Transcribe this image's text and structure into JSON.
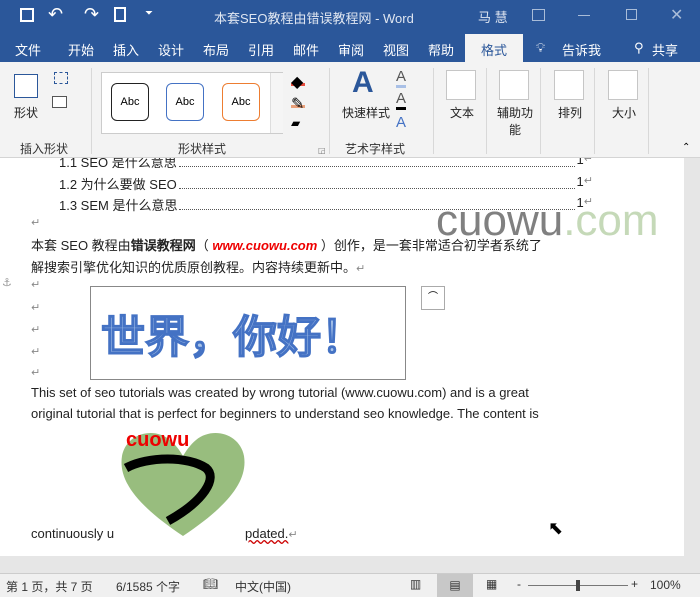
{
  "title": {
    "text": "本套SEO教程由错误教程网  -  Word",
    "user": "马 慧"
  },
  "quick_access": [
    "save-icon",
    "undo-icon",
    "redo-icon",
    "print-preview-icon",
    "customize-icon"
  ],
  "tabs": [
    {
      "label": "文件"
    },
    {
      "label": "开始"
    },
    {
      "label": "插入"
    },
    {
      "label": "设计"
    },
    {
      "label": "布局"
    },
    {
      "label": "引用"
    },
    {
      "label": "邮件"
    },
    {
      "label": "审阅"
    },
    {
      "label": "视图"
    },
    {
      "label": "帮助"
    },
    {
      "label": "格式"
    }
  ],
  "tell_me": "告诉我",
  "share": "共享",
  "ribbon": {
    "insert_shapes": {
      "shapes": "形状",
      "group": "插入形状"
    },
    "shape_styles": {
      "abc": [
        "Abc",
        "Abc",
        "Abc"
      ],
      "group": "形状样式"
    },
    "wordart": {
      "quick_styles": "快速样式",
      "group": "艺术字样式"
    },
    "text": "文本",
    "accessibility": "辅助功能",
    "arrange": "排列",
    "size": "大小"
  },
  "doc": {
    "toc": [
      {
        "text": "1.1 SEO 是什么意思",
        "page": "1"
      },
      {
        "text": "1.2  为什么要做 SEO",
        "page": "1"
      },
      {
        "text": "1.3 SEM 是什么意思",
        "page": "1"
      }
    ],
    "watermark": {
      "a": "cuowu",
      "b": ".com"
    },
    "p1a": "本套 SEO 教程由",
    "p1bold": "错误教程网",
    "p1paren": "（ ",
    "p1link": "www.cuowu.com",
    "p1c": " ）创作，是一套非常适合初学者系统了",
    "p2": "解搜索引擎优化知识的优质原创教程。内容持续更新中。",
    "wordart": "世界，你好！",
    "en1": "This set of seo tutorials was created by wrong tutorial (www.cuowu.com) and is a great",
    "en2": "original tutorial that is perfect for beginners to understand seo knowledge. The content is",
    "en3a": "continuously u",
    "en3b": "pdated.",
    "logo_text": "cuowu"
  },
  "status": {
    "page": "第 1 页，共 7 页",
    "words": "6/1585 个字",
    "language": "中文(中国)",
    "zoom": "100%",
    "zoom_level": 100
  }
}
